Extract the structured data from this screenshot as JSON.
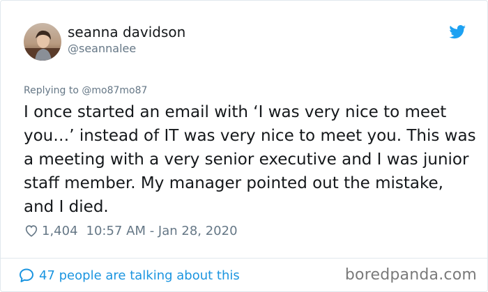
{
  "user": {
    "display_name": "seanna davidson",
    "handle": "@seannalee"
  },
  "reply": {
    "prefix": "Replying to",
    "to": "@mo87mo87"
  },
  "tweet": {
    "text": "I once started an email with ‘I was very nice to meet you…’ instead of IT was very nice to meet you. This was a meeting with a very senior executive and I was junior staff member. My manager pointed out the mistake, and I died.",
    "likes": "1,404",
    "timestamp": "10:57 AM - Jan 28, 2020"
  },
  "footer": {
    "talking": "47 people are talking about this"
  },
  "watermark": "boredpanda.com",
  "colors": {
    "twitter_blue": "#1da1f2",
    "link_blue": "#1b95e0",
    "muted": "#657786",
    "text": "#14171a"
  },
  "icons": {
    "brand": "twitter-bird-icon",
    "like": "heart-outline-icon",
    "conversation": "speech-bubble-icon"
  }
}
